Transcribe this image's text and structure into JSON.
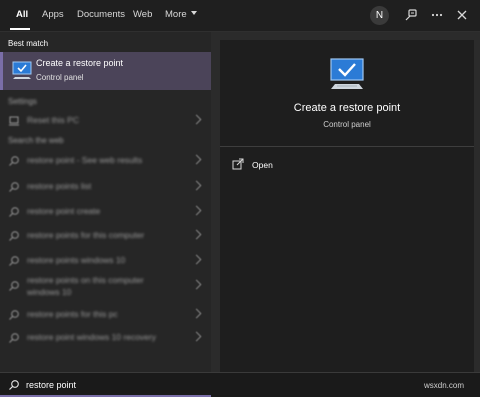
{
  "tabs": [
    {
      "label": "All",
      "active": true
    },
    {
      "label": "Apps"
    },
    {
      "label": "Documents"
    },
    {
      "label": "Web"
    },
    {
      "label": "More"
    }
  ],
  "user_initial": "N",
  "left": {
    "best_match_heading": "Best match",
    "best": {
      "title": "Create a restore point",
      "subtitle": "Control panel"
    },
    "settings_heading": "Settings",
    "settings_items": [
      {
        "label": "Reset this PC"
      }
    ],
    "web_heading": "Search the web",
    "web_items": [
      {
        "label": "restore point - See web results"
      },
      {
        "label": "restore points list"
      },
      {
        "label": "restore point create"
      },
      {
        "label": "restore points for this computer"
      },
      {
        "label": "restore points windows 10"
      },
      {
        "label": "restore points on this computer windows 10"
      },
      {
        "label": "restore points for this pc"
      },
      {
        "label": "restore point windows 10 recovery"
      }
    ]
  },
  "preview": {
    "title": "Create a restore point",
    "subtitle": "Control panel",
    "action_open": "Open"
  },
  "search": {
    "value": "restore point"
  },
  "watermark": "wsxdn.com",
  "colors": {
    "accent": "#7a6ea8",
    "highlight": "#4b4459"
  },
  "icons": {
    "search": "search-icon",
    "settings": "laptop-icon",
    "open": "open-icon"
  }
}
